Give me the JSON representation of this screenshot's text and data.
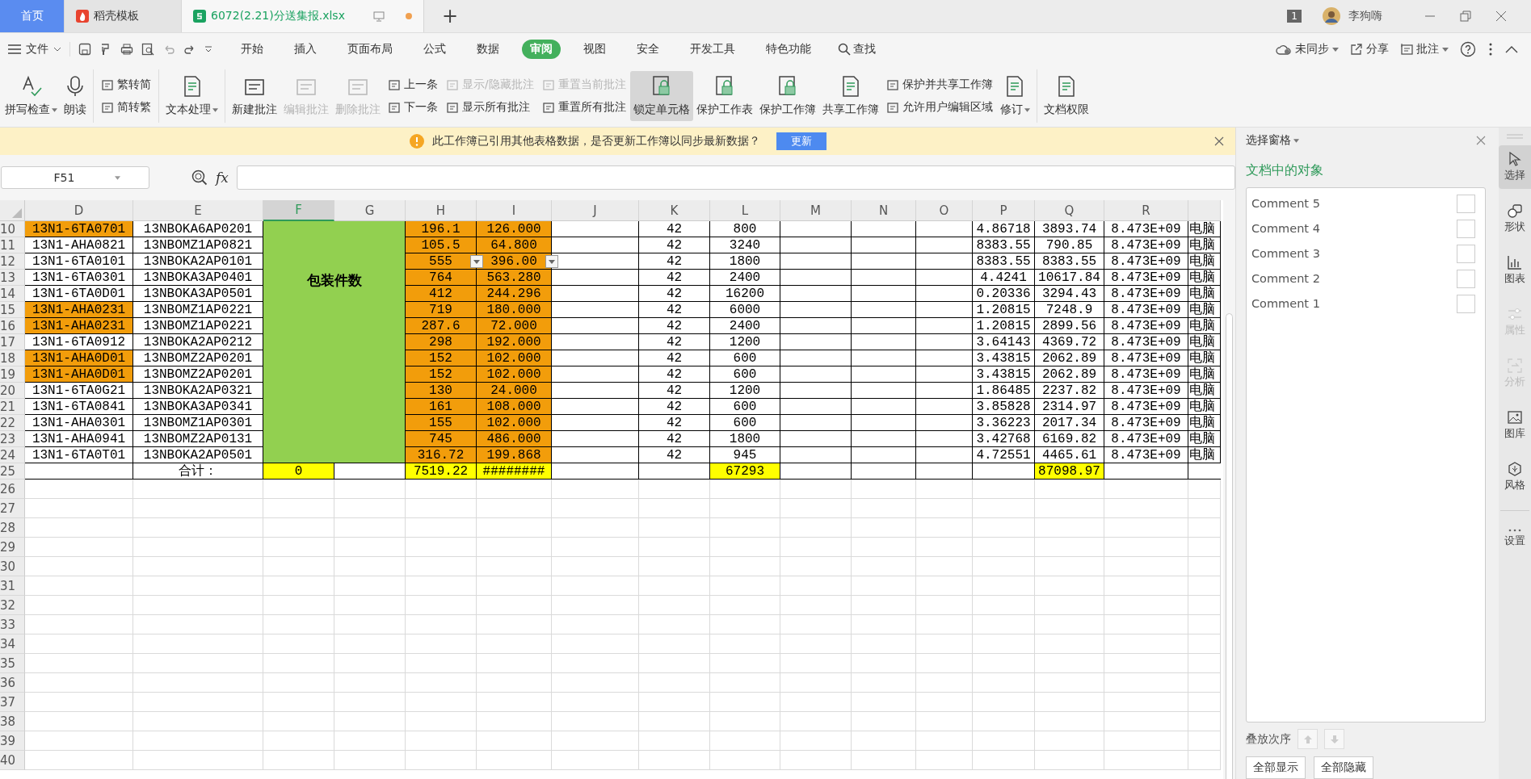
{
  "tabs": [
    {
      "label": "首页",
      "kind": "home",
      "selected": false
    },
    {
      "label": "稻壳模板",
      "kind": "template",
      "selected": false
    },
    {
      "label": "6072(2.21)分送集报.xlsx",
      "kind": "file",
      "selected": true
    }
  ],
  "new_tab": "+",
  "user": {
    "window_count": "1",
    "name": "李狗嗨"
  },
  "menu": {
    "file": "文件",
    "tabs": [
      {
        "label": "开始",
        "selected": false
      },
      {
        "label": "插入",
        "selected": false
      },
      {
        "label": "页面布局",
        "selected": false
      },
      {
        "label": "公式",
        "selected": false
      },
      {
        "label": "数据",
        "selected": false
      },
      {
        "label": "审阅",
        "selected": true
      },
      {
        "label": "视图",
        "selected": false
      },
      {
        "label": "安全",
        "selected": false
      },
      {
        "label": "开发工具",
        "selected": false
      },
      {
        "label": "特色功能",
        "selected": false
      }
    ],
    "search": "查找",
    "actions": [
      {
        "label": "未同步",
        "kind": "cloud",
        "dropdown": true
      },
      {
        "label": "分享",
        "kind": "share",
        "dropdown": false
      },
      {
        "label": "批注",
        "kind": "comment",
        "dropdown": true
      }
    ]
  },
  "ribbon": [
    {
      "kind": "big",
      "label": "拼写检查",
      "dropdown": true,
      "disabled": false,
      "selected": false
    },
    {
      "kind": "big",
      "label": "朗读",
      "dropdown": false,
      "disabled": false,
      "selected": false
    },
    {
      "kind": "separator"
    },
    {
      "kind": "stack",
      "items": [
        {
          "label": "繁转简",
          "disabled": false
        },
        {
          "label": "简转繁",
          "disabled": false
        }
      ]
    },
    {
      "kind": "separator"
    },
    {
      "kind": "big",
      "label": "文本处理",
      "dropdown": true,
      "disabled": false,
      "selected": false
    },
    {
      "kind": "separator"
    },
    {
      "kind": "big",
      "label": "新建批注",
      "dropdown": false,
      "disabled": false,
      "selected": false
    },
    {
      "kind": "big",
      "label": "编辑批注",
      "dropdown": false,
      "disabled": true,
      "selected": false
    },
    {
      "kind": "big",
      "label": "删除批注",
      "dropdown": false,
      "disabled": true,
      "selected": false
    },
    {
      "kind": "stack",
      "items": [
        {
          "label": "上一条",
          "disabled": false
        },
        {
          "label": "下一条",
          "disabled": false
        }
      ]
    },
    {
      "kind": "stack",
      "items": [
        {
          "label": "显示/隐藏批注",
          "disabled": true
        },
        {
          "label": "显示所有批注",
          "disabled": false
        }
      ]
    },
    {
      "kind": "stack",
      "items": [
        {
          "label": "重置当前批注",
          "disabled": true
        },
        {
          "label": "重置所有批注",
          "disabled": false
        }
      ]
    },
    {
      "kind": "big",
      "label": "锁定单元格",
      "dropdown": false,
      "disabled": false,
      "selected": true
    },
    {
      "kind": "big",
      "label": "保护工作表",
      "dropdown": false,
      "disabled": false,
      "selected": false
    },
    {
      "kind": "big",
      "label": "保护工作簿",
      "dropdown": false,
      "disabled": false,
      "selected": false
    },
    {
      "kind": "big",
      "label": "共享工作簿",
      "dropdown": false,
      "disabled": false,
      "selected": false
    },
    {
      "kind": "stack",
      "items": [
        {
          "label": "保护并共享工作簿",
          "disabled": false
        },
        {
          "label": "允许用户编辑区域",
          "disabled": false
        }
      ]
    },
    {
      "kind": "big",
      "label": "修订",
      "dropdown": true,
      "disabled": false,
      "selected": false
    },
    {
      "kind": "separator"
    },
    {
      "kind": "big",
      "label": "文档权限",
      "dropdown": false,
      "disabled": false,
      "selected": false
    }
  ],
  "notice": {
    "message": "此工作簿已引用其他表格数据，是否更新工作簿以同步最新数据？",
    "button": "更新"
  },
  "formula_bar": {
    "name_box": "F51",
    "fx": "fx"
  },
  "sheet": {
    "columns": [
      {
        "label": "D",
        "selected": false
      },
      {
        "label": "E",
        "selected": false
      },
      {
        "label": "F",
        "selected": true
      },
      {
        "label": "G",
        "selected": false
      },
      {
        "label": "H",
        "selected": false
      },
      {
        "label": "I",
        "selected": false
      },
      {
        "label": "J",
        "selected": false
      },
      {
        "label": "K",
        "selected": false
      },
      {
        "label": "L",
        "selected": false
      },
      {
        "label": "M",
        "selected": false
      },
      {
        "label": "N",
        "selected": false
      },
      {
        "label": "O",
        "selected": false
      },
      {
        "label": "P",
        "selected": false
      },
      {
        "label": "Q",
        "selected": false
      },
      {
        "label": "R",
        "selected": false
      }
    ],
    "merged_label": "包装件数",
    "rows": [
      {
        "number": "10",
        "d": "13N1-6TA0701",
        "d_highlighted": true,
        "e": "13NBOKA6AP0201",
        "h": "196.1",
        "i": "126.000",
        "k": "42",
        "l": "800",
        "p": "4.86718",
        "q": "3893.74",
        "r": "8.473E+09",
        "s": "电脑",
        "dropdown": false
      },
      {
        "number": "11",
        "d": "13N1-AHA0821",
        "d_highlighted": false,
        "e": "13NBOMZ1AP0821",
        "h": "105.5",
        "i": "64.800",
        "k": "42",
        "l": "3240",
        "p": "8383.55",
        "q": "790.85",
        "r": "8.473E+09",
        "s": "电脑",
        "dropdown": false
      },
      {
        "number": "12",
        "d": "13N1-6TA0101",
        "d_highlighted": false,
        "e": "13NBOKA2AP0101",
        "h": "555",
        "i": "396.00",
        "k": "42",
        "l": "1800",
        "p": "8383.55",
        "q": "8383.55",
        "r": "8.473E+09",
        "s": "电脑",
        "dropdown": true
      },
      {
        "number": "13",
        "d": "13N1-6TA0301",
        "d_highlighted": false,
        "e": "13NBOKA3AP0401",
        "h": "764",
        "i": "563.280",
        "k": "42",
        "l": "2400",
        "p": "4.4241",
        "q": "10617.84",
        "r": "8.473E+09",
        "s": "电脑",
        "dropdown": false
      },
      {
        "number": "14",
        "d": "13N1-6TA0D01",
        "d_highlighted": false,
        "e": "13NBOKA3AP0501",
        "h": "412",
        "i": "244.296",
        "k": "42",
        "l": "16200",
        "p": "0.20336",
        "q": "3294.43",
        "r": "8.473E+09",
        "s": "电脑",
        "dropdown": false
      },
      {
        "number": "15",
        "d": "13N1-AHA0231",
        "d_highlighted": true,
        "e": "13NBOMZ1AP0221",
        "h": "719",
        "i": "180.000",
        "k": "42",
        "l": "6000",
        "p": "1.20815",
        "q": "7248.9",
        "r": "8.473E+09",
        "s": "电脑",
        "dropdown": false
      },
      {
        "number": "16",
        "d": "13N1-AHA0231",
        "d_highlighted": true,
        "e": "13NBOMZ1AP0221",
        "h": "287.6",
        "i": "72.000",
        "k": "42",
        "l": "2400",
        "p": "1.20815",
        "q": "2899.56",
        "r": "8.473E+09",
        "s": "电脑",
        "dropdown": false
      },
      {
        "number": "17",
        "d": "13N1-6TA0912",
        "d_highlighted": false,
        "e": "13NBOKA2AP0212",
        "h": "298",
        "i": "192.000",
        "k": "42",
        "l": "1200",
        "p": "3.64143",
        "q": "4369.72",
        "r": "8.473E+09",
        "s": "电脑",
        "dropdown": false
      },
      {
        "number": "18",
        "d": "13N1-AHA0D01",
        "d_highlighted": true,
        "e": "13NBOMZ2AP0201",
        "h": "152",
        "i": "102.000",
        "k": "42",
        "l": "600",
        "p": "3.43815",
        "q": "2062.89",
        "r": "8.473E+09",
        "s": "电脑",
        "dropdown": false
      },
      {
        "number": "19",
        "d": "13N1-AHA0D01",
        "d_highlighted": true,
        "e": "13NBOMZ2AP0201",
        "h": "152",
        "i": "102.000",
        "k": "42",
        "l": "600",
        "p": "3.43815",
        "q": "2062.89",
        "r": "8.473E+09",
        "s": "电脑",
        "dropdown": false
      },
      {
        "number": "20",
        "d": "13N1-6TA0G21",
        "d_highlighted": false,
        "e": "13NBOKA2AP0321",
        "h": "130",
        "i": "24.000",
        "k": "42",
        "l": "1200",
        "p": "1.86485",
        "q": "2237.82",
        "r": "8.473E+09",
        "s": "电脑",
        "dropdown": false
      },
      {
        "number": "21",
        "d": "13N1-6TA0841",
        "d_highlighted": false,
        "e": "13NBOKA3AP0341",
        "h": "161",
        "i": "108.000",
        "k": "42",
        "l": "600",
        "p": "3.85828",
        "q": "2314.97",
        "r": "8.473E+09",
        "s": "电脑",
        "dropdown": false
      },
      {
        "number": "22",
        "d": "13N1-AHA0301",
        "d_highlighted": false,
        "e": "13NBOMZ1AP0301",
        "h": "155",
        "i": "102.000",
        "k": "42",
        "l": "600",
        "p": "3.36223",
        "q": "2017.34",
        "r": "8.473E+09",
        "s": "电脑",
        "dropdown": false
      },
      {
        "number": "23",
        "d": "13N1-AHA0941",
        "d_highlighted": false,
        "e": "13NBOMZ2AP0131",
        "h": "745",
        "i": "486.000",
        "k": "42",
        "l": "1800",
        "p": "3.42768",
        "q": "6169.82",
        "r": "8.473E+09",
        "s": "电脑",
        "dropdown": false
      },
      {
        "number": "24",
        "d": "13N1-6TA0T01",
        "d_highlighted": false,
        "e": "13NBOKA2AP0501",
        "h": "316.72",
        "i": "199.868",
        "k": "42",
        "l": "945",
        "p": "4.72551",
        "q": "4465.61",
        "r": "8.473E+09",
        "s": "电脑",
        "dropdown": false
      }
    ],
    "total": {
      "number": "25",
      "e": "合计：",
      "f": "0",
      "h": "7519.22",
      "i": "########",
      "l": "67293",
      "q": "87098.97"
    },
    "empty_rows": [
      "26",
      "27",
      "28",
      "29",
      "30",
      "31",
      "32",
      "33",
      "34",
      "35",
      "36",
      "37",
      "38",
      "39",
      "40"
    ]
  },
  "selection_pane": {
    "title": "选择窗格",
    "heading": "文档中的对象",
    "objects": [
      {
        "label": "Comment 5",
        "checked": false
      },
      {
        "label": "Comment 4",
        "checked": false
      },
      {
        "label": "Comment 3",
        "checked": false
      },
      {
        "label": "Comment 2",
        "checked": false
      },
      {
        "label": "Comment 1",
        "checked": false
      }
    ],
    "order_label": "叠放次序",
    "show_all": "全部显示",
    "hide_all": "全部隐藏"
  },
  "side_tools": [
    {
      "label": "选择",
      "selected": true,
      "disabled": false
    },
    {
      "label": "形状",
      "selected": false,
      "disabled": false
    },
    {
      "label": "图表",
      "selected": false,
      "disabled": false
    },
    {
      "label": "属性",
      "selected": false,
      "disabled": true
    },
    {
      "label": "分析",
      "selected": false,
      "disabled": true
    },
    {
      "label": "图库",
      "selected": false,
      "disabled": false
    },
    {
      "label": "风格",
      "selected": false,
      "disabled": false
    },
    {
      "label": "设置",
      "selected": false,
      "disabled": false
    }
  ]
}
